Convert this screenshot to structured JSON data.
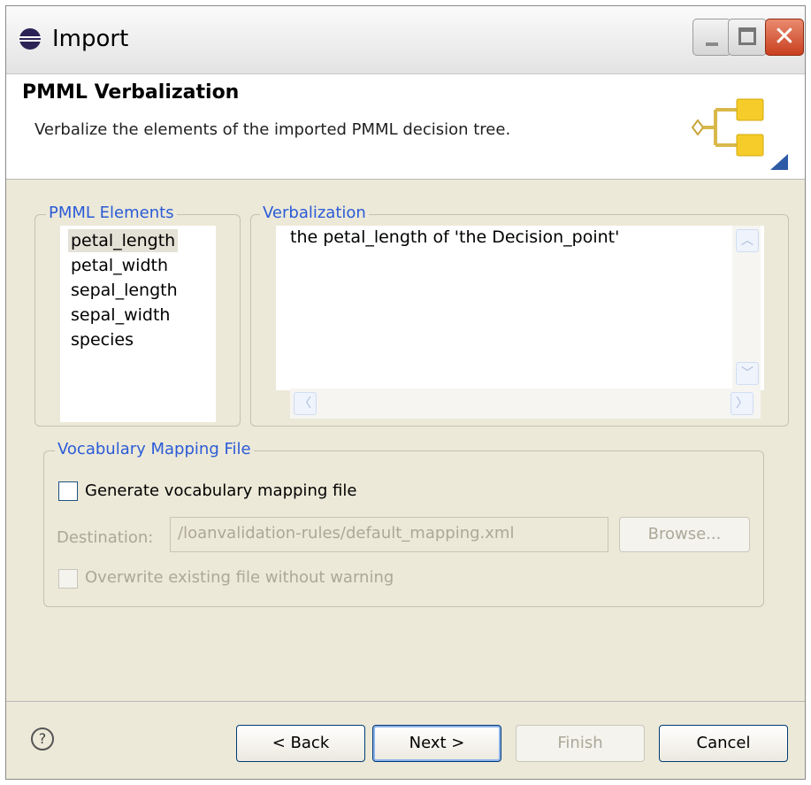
{
  "window": {
    "title": "Import",
    "icon": "eclipse-icon",
    "minimize_icon": "minimize-icon",
    "maximize_icon": "maximize-icon",
    "close_icon": "close-icon",
    "close_glyph": "✕"
  },
  "banner": {
    "title": "PMML Verbalization",
    "description": "Verbalize the elements of the imported PMML decision tree.",
    "icon": "decision-tree-wizard-icon"
  },
  "pmml_elements": {
    "label": "PMML Elements",
    "items": [
      "petal_length",
      "petal_width",
      "sepal_length",
      "sepal_width",
      "species"
    ],
    "selected": "petal_length"
  },
  "verbalization": {
    "label": "Verbalization",
    "text": "the petal_length of 'the Decision_point'",
    "scroll_up": "︿",
    "scroll_down": "﹀",
    "scroll_left": "〈",
    "scroll_right": "〉"
  },
  "vocabulary": {
    "label": "Vocabulary Mapping File",
    "generate_label": "Generate vocabulary mapping file",
    "destination_label": "Destination:",
    "destination_value": "/loanvalidation-rules/default_mapping.xml",
    "browse_label": "Browse...",
    "overwrite_label": "Overwrite existing file without warning"
  },
  "footer": {
    "help": "?",
    "back": "< Back",
    "next": "Next >",
    "finish": "Finish",
    "cancel": "Cancel"
  }
}
